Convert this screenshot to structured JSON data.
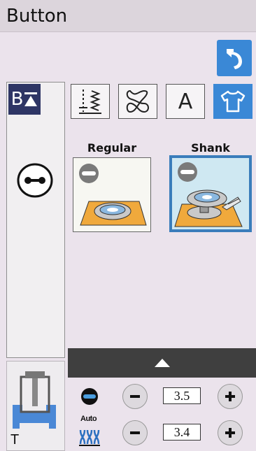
{
  "header": {
    "title": "Button"
  },
  "colors": {
    "accent": "#3a88d6",
    "selected_border": "#3a7dbb",
    "dark_nav": "#2e3565"
  },
  "toolbar": {
    "back_icon": "return-arrow-icon"
  },
  "left_panel": {
    "mode_button_text": "B",
    "mode_button_icon": "triangle-up-bar-icon",
    "hole_icon": "buttonhole-icon"
  },
  "presser_foot": {
    "label": "T",
    "icon": "presser-foot-icon"
  },
  "tabs": [
    {
      "icon": "utility-stitch-icon",
      "active": false
    },
    {
      "icon": "decorative-stitch-icon",
      "active": false
    },
    {
      "label": "A",
      "icon": "character-icon",
      "active": false
    },
    {
      "icon": "garment-icon",
      "active": true
    }
  ],
  "options": [
    {
      "label": "Regular",
      "selected": false,
      "icon": "regular-button-icon"
    },
    {
      "label": "Shank",
      "selected": true,
      "icon": "shank-button-icon"
    }
  ],
  "expand": {
    "icon": "chevron-up-icon"
  },
  "settings": [
    {
      "icon": "button-width-icon",
      "value": "3.5"
    },
    {
      "icon_label": "Auto",
      "icon": "auto-stitch-icon",
      "value": "3.4"
    }
  ]
}
